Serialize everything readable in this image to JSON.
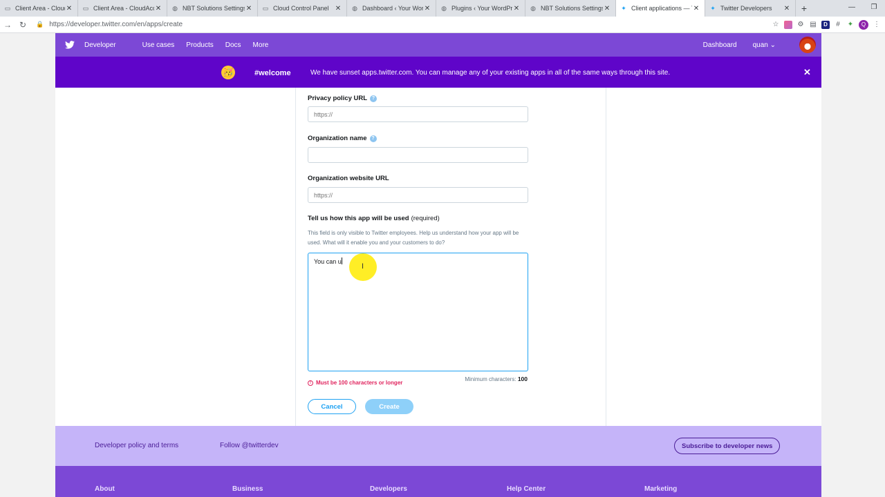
{
  "browser": {
    "tabs": [
      {
        "title": "Client Area - CloudAcco",
        "icon": "page-icon",
        "active": false
      },
      {
        "title": "Client Area - CloudAcco",
        "icon": "page-icon",
        "active": false
      },
      {
        "title": "NBT Solutions Settings",
        "icon": "globe-icon",
        "active": false
      },
      {
        "title": "Cloud Control Panel",
        "icon": "page-icon",
        "active": false
      },
      {
        "title": "Dashboard ‹ Your Word",
        "icon": "globe-icon",
        "active": false
      },
      {
        "title": "Plugins ‹ Your WordPre",
        "icon": "globe-icon",
        "active": false
      },
      {
        "title": "NBT Solutions Settings",
        "icon": "globe-icon",
        "active": false
      },
      {
        "title": "Client applications — T",
        "icon": "twitter-icon",
        "active": true
      },
      {
        "title": "Twitter Developers",
        "icon": "twitter-icon",
        "active": false
      }
    ],
    "url": "https://developer.twitter.com/en/apps/create",
    "profile_initial": "Q"
  },
  "topnav": {
    "brand": "Developer",
    "links": [
      "Use cases",
      "Products",
      "Docs",
      "More"
    ],
    "dashboard": "Dashboard",
    "user": "quan ⌄"
  },
  "banner": {
    "emoji": "🥳",
    "tag": "#welcome",
    "message": "We have sunset apps.twitter.com. You can manage any of your existing apps in all of the same ways through this site.",
    "close": "✕"
  },
  "form": {
    "privacy_label": "Privacy policy URL",
    "privacy_placeholder": "https://",
    "org_name_label": "Organization name",
    "org_name_value": "",
    "org_url_label": "Organization website URL",
    "org_url_placeholder": "https://",
    "usage_label": "Tell us how this app will be used",
    "usage_required": "(required)",
    "usage_help": "This field is only visible to Twitter employees. Help us understand how your app will be used. What will it enable you and your customers to do?",
    "usage_value": "You can u",
    "error": "Must be 100 characters or longer",
    "min_chars_label": "Minimum characters:",
    "min_chars_value": "100",
    "cancel": "Cancel",
    "create": "Create"
  },
  "footer": {
    "policy": "Developer policy and terms",
    "follow": "Follow @twitterdev",
    "subscribe": "Subscribe to developer news",
    "columns": [
      "About",
      "Business",
      "Developers",
      "Help Center",
      "Marketing"
    ]
  },
  "colors": {
    "nav_purple": "#7c48d6",
    "banner_purple": "#5f05c9",
    "twitter_blue": "#1da1f2",
    "error_red": "#e0245e",
    "footer_lavender": "#c5b4f9"
  }
}
